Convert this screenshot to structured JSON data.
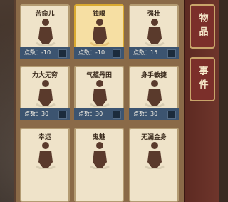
{
  "side_tabs": {
    "items": "物品",
    "events": "事件"
  },
  "cards": [
    {
      "name": "苦命儿",
      "points": "点数：-10",
      "selected": false
    },
    {
      "name": "独眼",
      "points": "点数：-10",
      "selected": true
    },
    {
      "name": "强壮",
      "points": "点数：15",
      "selected": false
    },
    {
      "name": "力大无穷",
      "points": "点数：30",
      "selected": false
    },
    {
      "name": "气蕴丹田",
      "points": "点数：30",
      "selected": false
    },
    {
      "name": "身手敏捷",
      "points": "点数：30",
      "selected": false
    },
    {
      "name": "幸运",
      "points": "",
      "selected": false
    },
    {
      "name": "鬼魅",
      "points": "",
      "selected": false
    },
    {
      "name": "无漏金身",
      "points": "",
      "selected": false
    }
  ],
  "colors": {
    "panel": "#8a6a48",
    "card": "#efe3c9",
    "selected": "#f6dfa3",
    "points_bar": "#3c5470",
    "figure": "#5a3a2c"
  }
}
